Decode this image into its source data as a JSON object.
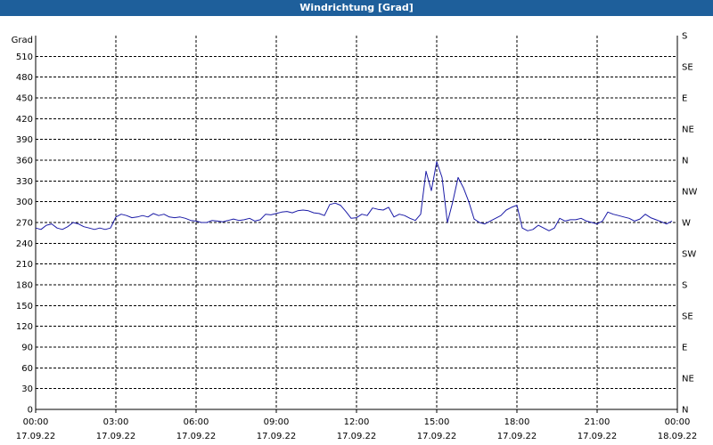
{
  "window": {
    "title": "Windrichtung [Grad]"
  },
  "chart_data": {
    "type": "line",
    "title": "Windrichtung [Grad]",
    "ylabel": "Grad",
    "ylim": [
      0,
      540
    ],
    "yticks": [
      0,
      30,
      60,
      90,
      120,
      150,
      180,
      210,
      240,
      270,
      300,
      330,
      360,
      390,
      420,
      450,
      480,
      510
    ],
    "right_axis_labels": [
      "N",
      "NE",
      "E",
      "SE",
      "S",
      "SW",
      "W",
      "NW",
      "N",
      "NE",
      "E",
      "SE",
      "S"
    ],
    "xlim": [
      0,
      24
    ],
    "xtick_labels": [
      {
        "time": "00:00",
        "date": "17.09.22",
        "hour": 0
      },
      {
        "time": "03:00",
        "date": "17.09.22",
        "hour": 3
      },
      {
        "time": "06:00",
        "date": "17.09.22",
        "hour": 6
      },
      {
        "time": "09:00",
        "date": "17.09.22",
        "hour": 9
      },
      {
        "time": "12:00",
        "date": "17.09.22",
        "hour": 12
      },
      {
        "time": "15:00",
        "date": "17.09.22",
        "hour": 15
      },
      {
        "time": "18:00",
        "date": "17.09.22",
        "hour": 18
      },
      {
        "time": "21:00",
        "date": "17.09.22",
        "hour": 21
      },
      {
        "time": "00:00",
        "date": "18.09.22",
        "hour": 24
      }
    ],
    "grid": true,
    "line_color": "#1a1aa6",
    "series": [
      {
        "name": "",
        "x": [
          0,
          0.2,
          0.4,
          0.6,
          0.8,
          1,
          1.2,
          1.4,
          1.6,
          1.8,
          2,
          2.2,
          2.4,
          2.6,
          2.8,
          3,
          3.2,
          3.4,
          3.6,
          3.8,
          4,
          4.2,
          4.4,
          4.6,
          4.8,
          5,
          5.2,
          5.4,
          5.6,
          5.8,
          6,
          6.2,
          6.4,
          6.6,
          6.8,
          7,
          7.2,
          7.4,
          7.6,
          7.8,
          8,
          8.2,
          8.4,
          8.6,
          8.8,
          9,
          9.2,
          9.4,
          9.6,
          9.8,
          10,
          10.2,
          10.4,
          10.6,
          10.8,
          11,
          11.2,
          11.4,
          11.6,
          11.8,
          12,
          12.2,
          12.4,
          12.6,
          12.8,
          13,
          13.2,
          13.4,
          13.6,
          13.8,
          14,
          14.2,
          14.4,
          14.6,
          14.8,
          15,
          15.2,
          15.4,
          15.6,
          15.8,
          16,
          16.2,
          16.4,
          16.6,
          16.8,
          17,
          17.2,
          17.4,
          17.6,
          17.8,
          18,
          18.2,
          18.4,
          18.6,
          18.8,
          19,
          19.2,
          19.4,
          19.6,
          19.8,
          20,
          20.2,
          20.4,
          20.6,
          20.8,
          21,
          21.2,
          21.4,
          21.6,
          21.8,
          22,
          22.2,
          22.4,
          22.6,
          22.8,
          23,
          23.2,
          23.4,
          23.6,
          23.8,
          24
        ],
        "y": [
          262,
          260,
          266,
          268,
          262,
          260,
          264,
          270,
          268,
          264,
          262,
          260,
          262,
          260,
          262,
          278,
          282,
          280,
          277,
          278,
          280,
          278,
          283,
          280,
          282,
          278,
          277,
          278,
          276,
          273,
          272,
          270,
          270,
          273,
          272,
          271,
          273,
          275,
          273,
          274,
          276,
          272,
          274,
          282,
          281,
          283,
          285,
          286,
          284,
          287,
          288,
          287,
          284,
          283,
          280,
          296,
          298,
          295,
          286,
          276,
          277,
          282,
          280,
          291,
          289,
          288,
          292,
          278,
          282,
          280,
          276,
          273,
          282,
          344,
          316,
          358,
          335,
          270,
          300,
          335,
          320,
          300,
          275,
          270,
          268,
          272,
          276,
          280,
          288,
          292,
          295,
          262,
          258,
          260,
          266,
          262,
          258,
          262,
          276,
          272,
          274,
          274,
          276,
          272,
          270,
          268,
          272,
          285,
          282,
          280,
          278,
          276,
          272,
          275,
          282,
          277,
          274,
          271,
          268,
          272
        ],
        "values": [
          [
            0,
            262
          ],
          [
            0.2,
            260
          ],
          [
            0.4,
            266
          ],
          [
            0.6,
            268
          ],
          [
            0.8,
            262
          ],
          [
            1,
            260
          ],
          [
            1.2,
            264
          ],
          [
            1.4,
            270
          ],
          [
            1.6,
            268
          ],
          [
            1.8,
            264
          ],
          [
            2,
            262
          ],
          [
            2.2,
            260
          ],
          [
            2.4,
            262
          ],
          [
            2.6,
            260
          ],
          [
            2.8,
            262
          ],
          [
            3,
            278
          ],
          [
            3.2,
            282
          ],
          [
            3.4,
            280
          ],
          [
            3.6,
            277
          ],
          [
            3.8,
            278
          ],
          [
            4,
            280
          ],
          [
            4.2,
            278
          ],
          [
            4.4,
            283
          ],
          [
            4.6,
            280
          ],
          [
            4.8,
            282
          ],
          [
            5,
            278
          ],
          [
            5.2,
            277
          ],
          [
            5.4,
            278
          ],
          [
            5.6,
            276
          ],
          [
            5.8,
            273
          ],
          [
            6,
            272
          ],
          [
            6.2,
            270
          ],
          [
            6.4,
            270
          ],
          [
            6.6,
            273
          ],
          [
            6.8,
            272
          ],
          [
            7,
            271
          ],
          [
            7.2,
            273
          ],
          [
            7.4,
            275
          ],
          [
            7.6,
            273
          ],
          [
            7.8,
            274
          ],
          [
            8,
            276
          ],
          [
            8.2,
            272
          ],
          [
            8.4,
            274
          ],
          [
            8.6,
            282
          ],
          [
            8.8,
            281
          ],
          [
            9,
            283
          ],
          [
            9.2,
            285
          ],
          [
            9.4,
            286
          ],
          [
            9.6,
            284
          ],
          [
            9.8,
            287
          ],
          [
            10,
            288
          ],
          [
            10.2,
            287
          ],
          [
            10.4,
            284
          ],
          [
            10.6,
            283
          ],
          [
            10.8,
            280
          ],
          [
            11,
            296
          ],
          [
            11.2,
            298
          ],
          [
            11.4,
            295
          ],
          [
            11.6,
            286
          ],
          [
            11.8,
            276
          ],
          [
            12,
            277
          ],
          [
            12.2,
            282
          ],
          [
            12.4,
            280
          ],
          [
            12.6,
            291
          ],
          [
            12.8,
            289
          ],
          [
            13,
            288
          ],
          [
            13.2,
            292
          ],
          [
            13.4,
            278
          ],
          [
            13.6,
            282
          ],
          [
            13.8,
            280
          ],
          [
            14,
            276
          ],
          [
            14.2,
            273
          ],
          [
            14.4,
            282
          ],
          [
            14.6,
            344
          ],
          [
            14.8,
            316
          ],
          [
            15,
            358
          ],
          [
            15.2,
            335
          ],
          [
            15.4,
            270
          ],
          [
            15.6,
            300
          ],
          [
            15.8,
            335
          ],
          [
            16,
            320
          ],
          [
            16.2,
            300
          ],
          [
            16.4,
            275
          ],
          [
            16.6,
            270
          ],
          [
            16.8,
            268
          ],
          [
            17,
            272
          ],
          [
            17.2,
            276
          ],
          [
            17.4,
            280
          ],
          [
            17.6,
            288
          ],
          [
            17.8,
            292
          ],
          [
            18,
            295
          ],
          [
            18.2,
            262
          ],
          [
            18.4,
            258
          ],
          [
            18.6,
            260
          ],
          [
            18.8,
            266
          ],
          [
            19,
            262
          ],
          [
            19.2,
            258
          ],
          [
            19.4,
            262
          ],
          [
            19.6,
            276
          ],
          [
            19.8,
            272
          ],
          [
            20,
            274
          ],
          [
            20.2,
            274
          ],
          [
            20.4,
            276
          ],
          [
            20.6,
            272
          ],
          [
            20.8,
            270
          ],
          [
            21,
            268
          ],
          [
            21.2,
            272
          ],
          [
            21.4,
            285
          ],
          [
            21.6,
            282
          ],
          [
            21.8,
            280
          ],
          [
            22,
            278
          ],
          [
            22.2,
            276
          ],
          [
            22.4,
            272
          ],
          [
            22.6,
            275
          ],
          [
            22.8,
            282
          ],
          [
            23,
            277
          ],
          [
            23.2,
            274
          ],
          [
            23.4,
            271
          ],
          [
            23.6,
            268
          ],
          [
            23.8,
            272
          ]
        ]
      }
    ]
  }
}
